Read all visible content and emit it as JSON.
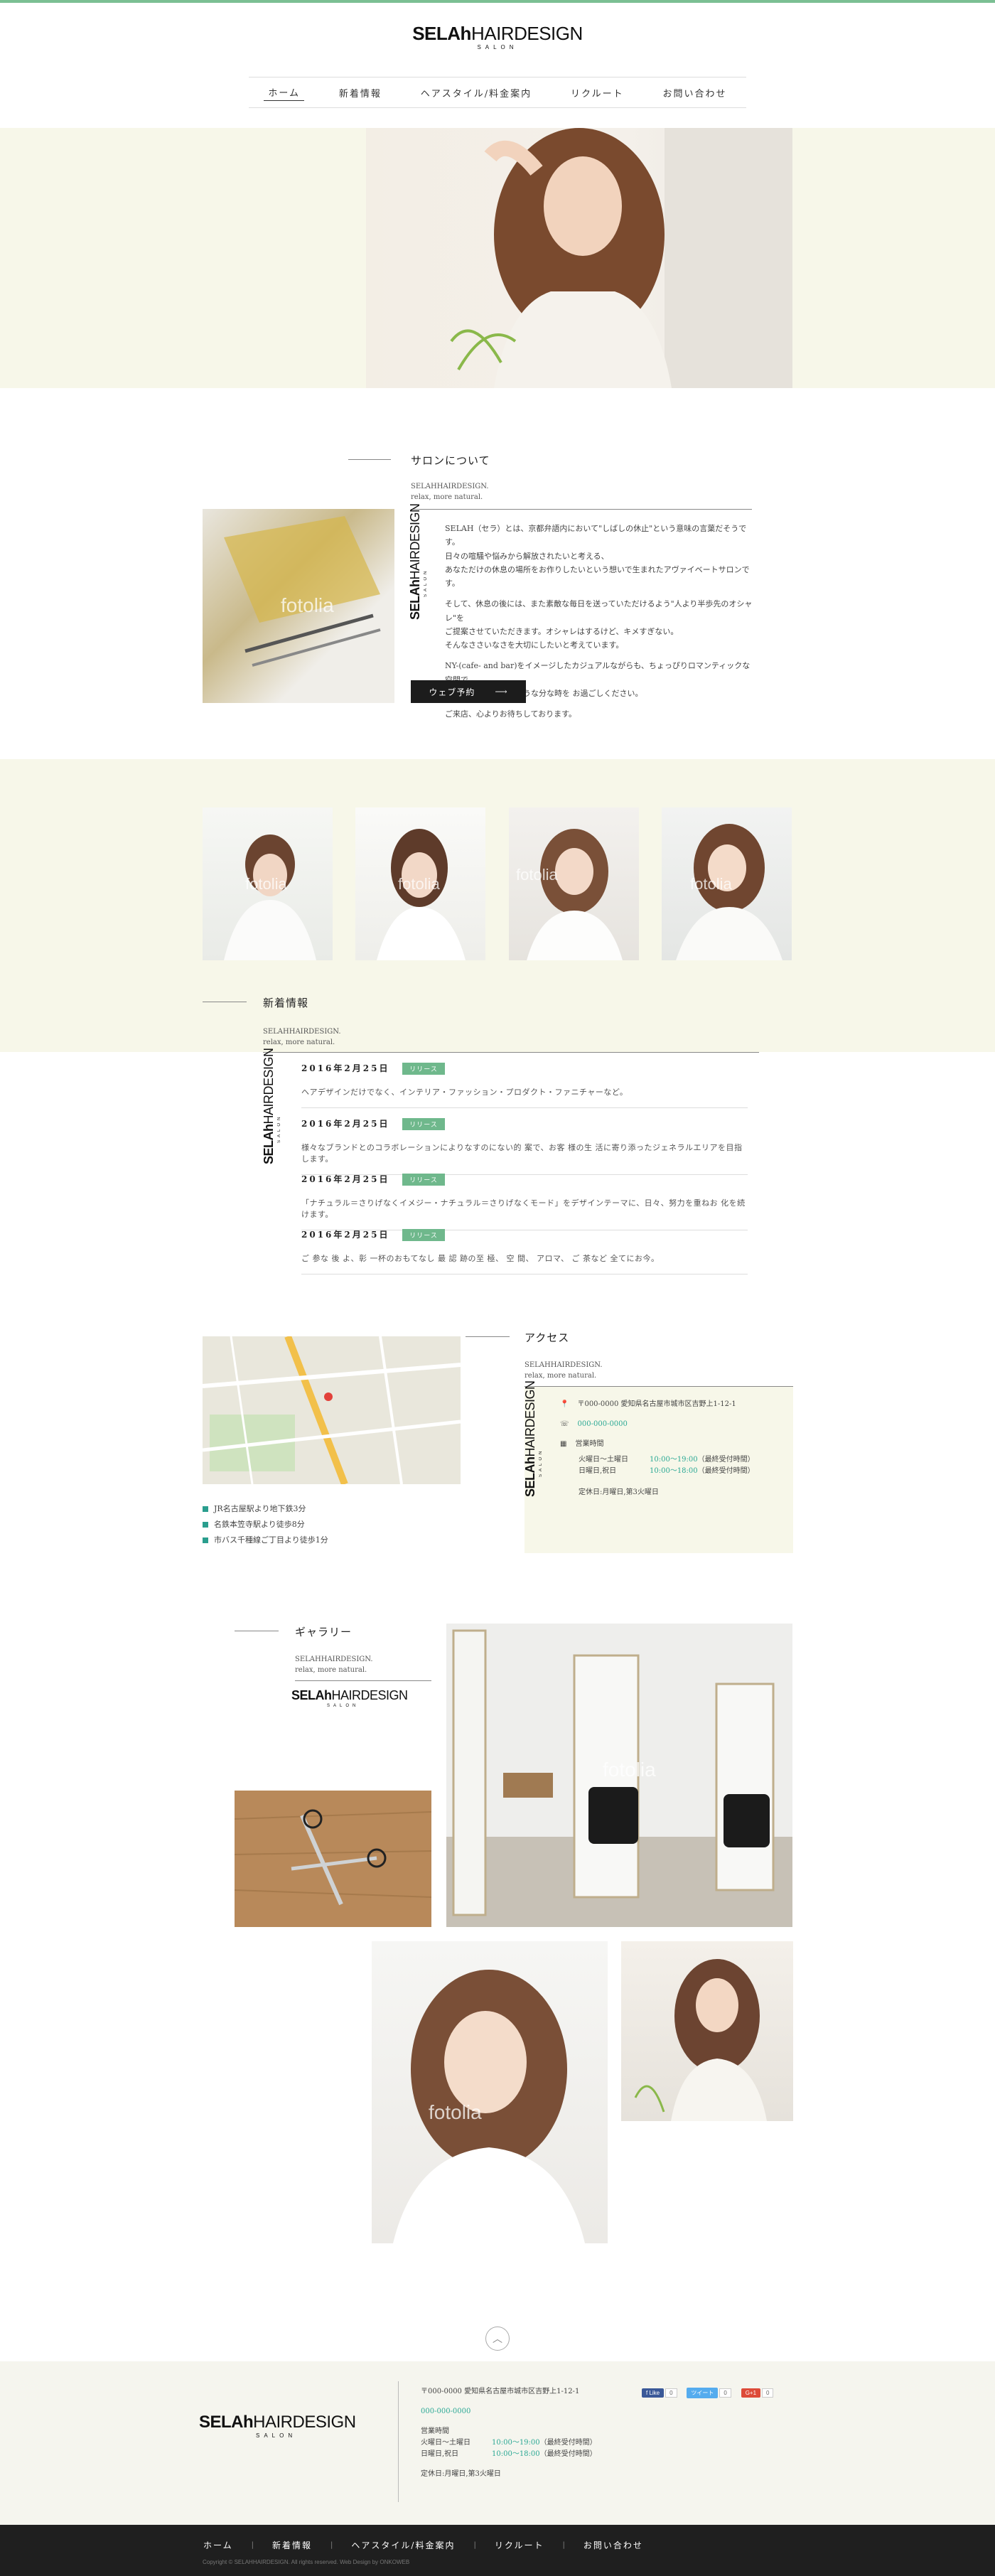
{
  "brand": {
    "name_bold": "SELAh",
    "name_rest": "HAIRDESIGN",
    "sub": "SALON"
  },
  "nav": [
    "ホーム",
    "新着情報",
    "ヘアスタイル/料金案内",
    "リクルート",
    "お問い合わせ"
  ],
  "watermark": "fotolia",
  "salon": {
    "title": "サロンについて",
    "sub1": "SELAHHAIRDESIGN.",
    "sub2": "relax, more natural.",
    "p1": "SELAH（セラ）とは、京都弁語内において\"しばしの休止\"という意味の言葉だそうです。",
    "p2": "日々の喧騒や悩みから解放されたいと考える、",
    "p3": "あなただけの休息の場所をお作りしたいという想いで生まれたアヴァイベートサロンです。",
    "p4": "そして、休息の後には、また素敵な毎日を送っていただけるよう\"人より半歩先のオシャレ\"を",
    "p5": "ご提案させていただきます。オシャレはするけど、キメすぎない。",
    "p6": "そんなささいなさを大切にしたいと考えています。",
    "p7": "NY-(cafe- and bar)をイメージしたカジュアルながらも、ちょっぴりロマンティックな空間で、",
    "p8": "日頃の時間を忘れるような分な時を お過ごしください。",
    "p9": "ご来店、心よりお待ちしております。",
    "button": "ウェブ予約"
  },
  "news": {
    "title": "新着情報",
    "sub1": "SELAHHAIRDESIGN.",
    "sub2": "relax, more natural.",
    "items": [
      {
        "date": "2016年2月25日",
        "tag": "リリース",
        "text": "ヘアデザインだけでなく、インテリア・ファッション・プロダクト・ファニチャーなど。"
      },
      {
        "date": "2016年2月25日",
        "tag": "リリース",
        "text": "様々なブランドとのコラボレーションによりなすのにない的 案で、お客 様の生 活に寄り添ったジェネラルエリアを目指します。"
      },
      {
        "date": "2016年2月25日",
        "tag": "リリース",
        "text": "「ナチュラル＝さりげなくイメジー・ナチュラル＝さりげなくモード」をデザインテーマに、日々、努力を重ねお 化を続けます。"
      },
      {
        "date": "2016年2月25日",
        "tag": "リリース",
        "text": "ご 参な 後 よ、彰 一杯のおもてなし 最 認 跡の至 極、 空 間、 アロマ、 ご 茶など 全てにお今。"
      }
    ]
  },
  "access": {
    "title": "アクセス",
    "sub1": "SELAHHAIRDESIGN.",
    "sub2": "relax, more natural.",
    "address": "〒000-0000 愛知県名古屋市城市区吉野上1-12-1",
    "phone": "000-000-0000",
    "hours_label": "営業時間",
    "hours": [
      {
        "days": "火曜日〜土曜日",
        "time": "10:00〜19:00",
        "note": "（最終受付時間）"
      },
      {
        "days": "日曜日,祝日",
        "time": "10:00〜18:00",
        "note": "（最終受付時間）"
      }
    ],
    "closed": "定休日:月曜日,第3火曜日",
    "directions": [
      "JR名古屋駅より地下鉄3分",
      "名鉄本笠寺駅より徒歩8分",
      "市バス千種線ご丁目より徒歩1分"
    ]
  },
  "gallery": {
    "title": "ギャラリー",
    "sub1": "SELAHHAIRDESIGN.",
    "sub2": "relax, more natural."
  },
  "footer": {
    "address": "〒000-0000 愛知県名古屋市城市区吉野上1-12-1",
    "phone": "000-000-0000",
    "hours_label": "営業時間",
    "hours": [
      {
        "days": "火曜日〜土曜日",
        "time": "10:00〜19:00",
        "note": "（最終受付時間）"
      },
      {
        "days": "日曜日,祝日",
        "time": "10:00〜18:00",
        "note": "（最終受付時間）"
      }
    ],
    "closed": "定休日:月曜日,第3火曜日",
    "social": {
      "facebook": "f Like",
      "fb_count": "0",
      "twitter": "ツイート",
      "tw_count": "0",
      "google": "G+1",
      "g_count": "0"
    },
    "nav": [
      "ホーム",
      "新着情報",
      "ヘアスタイル/料金案内",
      "リクルート",
      "お問い合わせ"
    ],
    "copyright": "Copyright © SELAHHAIRDESIGN. All rights reserved. Web Design by ONKOWEB"
  },
  "colors": {
    "accent": "#7bbf93",
    "teal": "#2aa894",
    "cream": "#f7f7e9",
    "dark": "#1f1f1f"
  }
}
